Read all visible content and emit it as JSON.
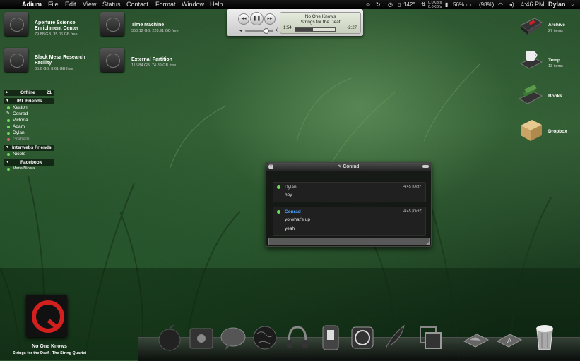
{
  "menubar": {
    "app_name": "Adium",
    "menus": [
      "File",
      "Edit",
      "View",
      "Status",
      "Contact",
      "Format",
      "Window",
      "Help"
    ],
    "temperature": "142°",
    "network_up": "0.0KB/s",
    "network_down": "0.0KB/s",
    "cpu_percent": "56%",
    "battery": "(98%)",
    "clock": "4:46 PM",
    "user": "Dylan"
  },
  "disks": [
    {
      "name": "Aperture Science Enrichment Center",
      "info": "79.88 GB, 35.06 GB free"
    },
    {
      "name": "Time Machine",
      "info": "350.12 GB, 228.91 GB free"
    },
    {
      "name": "Black Mesa Research Facility",
      "info": "35.6 GB, 8.61 GB free"
    },
    {
      "name": "External Partition",
      "info": "115.84 GB, 74.89 GB free"
    }
  ],
  "itunes": {
    "song": "No One Knows",
    "album": "Strings for the Deaf",
    "elapsed": "1:54",
    "remaining": "-2:27",
    "progress": 0.44,
    "volume": 0.75
  },
  "buddy_list": {
    "groups": [
      {
        "name": "Offline",
        "count": "21",
        "contacts": []
      },
      {
        "name": "IRL Friends",
        "count": "",
        "contacts": [
          "Keaton",
          "Conrad",
          "Victoria",
          "Adam",
          "Dylan",
          "Graham"
        ]
      },
      {
        "name": "Interwebs Friends",
        "count": "",
        "contacts": [
          "Nicole"
        ]
      },
      {
        "name": "Facebook",
        "count": "",
        "contacts": [
          "Maria Nicora"
        ]
      }
    ]
  },
  "desktop_icons": [
    {
      "name": "Archive",
      "count": "27 items"
    },
    {
      "name": "Temp",
      "count": "13 items"
    },
    {
      "name": "Books",
      "count": ""
    },
    {
      "name": "Dropbox",
      "count": ""
    }
  ],
  "chat": {
    "title": "Conrad",
    "messages": [
      {
        "sender": "Dylan",
        "time": "4:45 [Oct7]",
        "lines": [
          "hey"
        ]
      },
      {
        "sender": "Conrad",
        "time": "4:45 [Oct7]",
        "lines": [
          "yo what's up",
          "yeah"
        ]
      }
    ]
  },
  "now_playing": {
    "title": "No One Knows",
    "subtitle": "Strings for the Deaf - The String Quartet"
  },
  "dock_items": [
    "apple-icon",
    "finder-icon",
    "ichat-icon",
    "globe-icon",
    "headphones-icon",
    "system-icon",
    "clock-icon",
    "feather-icon",
    "window-icon",
    "pictures-icon",
    "applications-icon",
    "trash-icon"
  ],
  "colors": {
    "online": "#6ddc5a",
    "accent_blue": "#4aa3ff",
    "album_red": "#d41f1f"
  }
}
